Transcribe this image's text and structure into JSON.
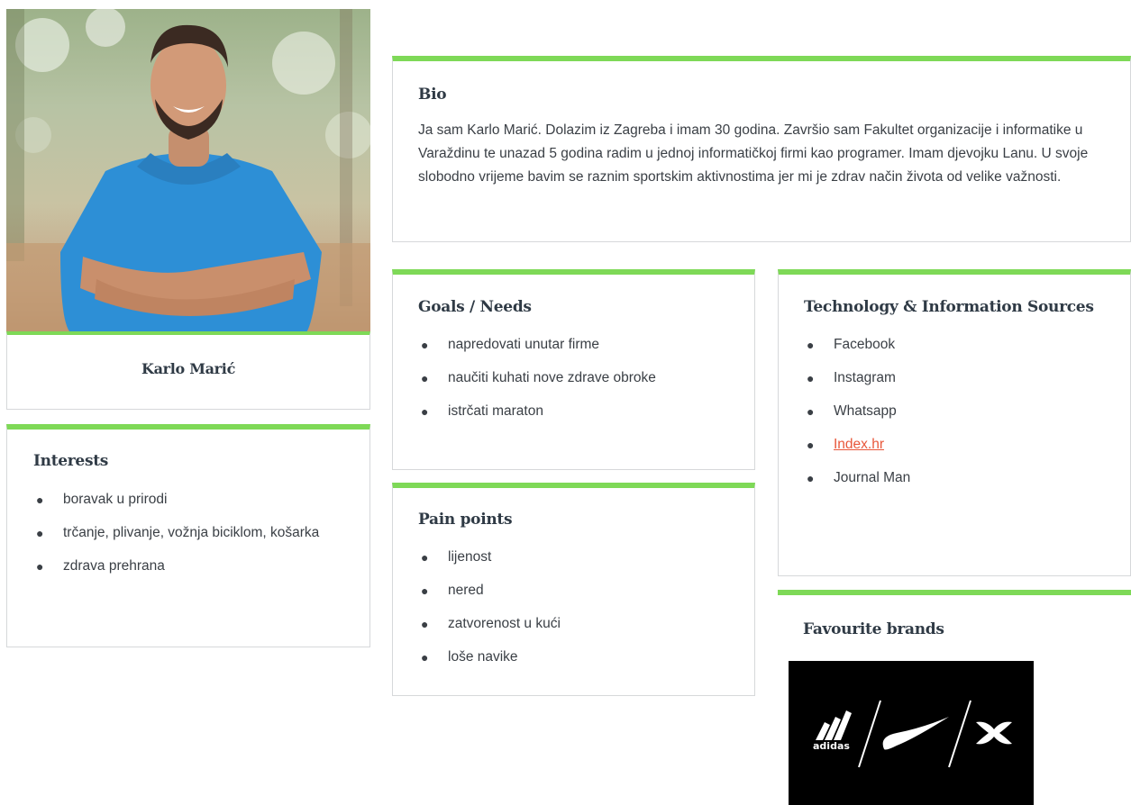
{
  "profile": {
    "name": "Karlo Marić",
    "photo_icon": "person-photo"
  },
  "bio": {
    "title": "Bio",
    "text": "Ja sam Karlo Marić. Dolazim iz Zagreba i imam 30 godina. Završio sam Fakultet organizacije i informatike u Varaždinu te unazad 5 godina radim u jednoj informatičkoj firmi kao programer. Imam djevojku Lanu. U svoje slobodno vrijeme bavim se raznim sportskim aktivnostima jer mi je zdrav način života od velike važnosti."
  },
  "interests": {
    "title": "Interests",
    "items": [
      "boravak u prirodi",
      "trčanje, plivanje, vožnja biciklom, košarka",
      "zdrava prehrana"
    ]
  },
  "goals": {
    "title": "Goals / Needs",
    "items": [
      "napredovati unutar firme",
      "naučiti kuhati nove zdrave obroke",
      "istrčati maraton"
    ]
  },
  "pain_points": {
    "title": "Pain points",
    "items": [
      "lijenost",
      "nered",
      "zatvorenost u kući",
      "loše navike"
    ]
  },
  "technology": {
    "title": "Technology & Information Sources",
    "items": [
      {
        "label": "Facebook",
        "link": false
      },
      {
        "label": "Instagram",
        "link": false
      },
      {
        "label": "Whatsapp",
        "link": false
      },
      {
        "label": "Index.hr",
        "link": true
      },
      {
        "label": "Journal Man",
        "link": false
      }
    ]
  },
  "brands": {
    "title": "Favourite brands",
    "logo_text": "adidas",
    "icons": [
      "adidas-logo-icon",
      "nike-swoosh-icon",
      "under-armour-logo-icon"
    ]
  },
  "colors": {
    "accent": "#7ed957",
    "link": "#e8573a",
    "text": "#3a3f45",
    "heading": "#2f3a45"
  }
}
